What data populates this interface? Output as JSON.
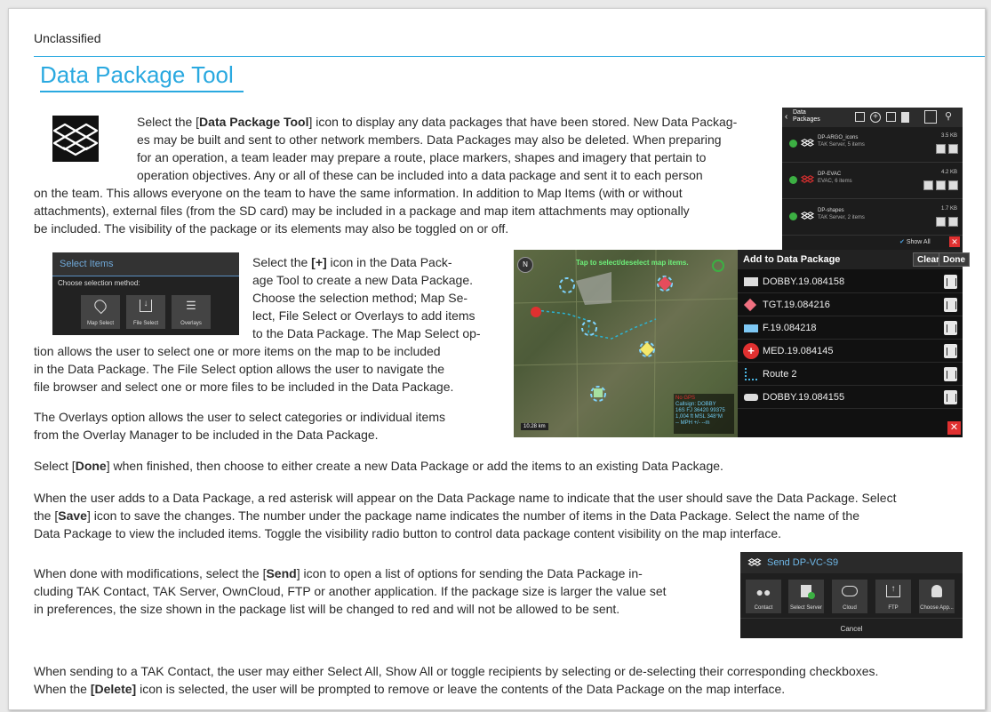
{
  "header": {
    "classification": "Unclassified",
    "title": "Data Package Tool"
  },
  "intro": {
    "l1_pre": "Select the [",
    "l1_bold": "Data Package Tool",
    "l1_post": "] icon to display any data packages that have been stored. New Data Packag-",
    "l2": "es may be built and sent to other network members. Data Packages may also be deleted. When preparing",
    "l3": "for an operation, a team leader may prepare a route, place markers, shapes and imagery that pertain to",
    "l4": "operation objectives. Any or all of these can be included into a data package and sent it to each person",
    "l5": "on the team. This allows everyone on the team to have the same information.  In addition to Map Items (with or without",
    "l6": "attachments), external files (from the SD card) may be included in a package and map item attachments may optionally",
    "l7": "be included. The visibility of the package or its elements may also be toggled on or off."
  },
  "data_packages_panel": {
    "title_line1": "Data",
    "title_line2": "Packages",
    "items": [
      {
        "name": "DP-ARGO_icons",
        "sub": "TAK Server, 5 items",
        "size": "3.5 KB"
      },
      {
        "name": "DP-EVAC",
        "sub": "EVAC, 6 items",
        "size": "4.2 KB"
      },
      {
        "name": "DP-shapes",
        "sub": "TAK Server, 2 items",
        "size": "1.7 KB"
      }
    ],
    "show_all": "Show All",
    "accent_green": "#3cb043",
    "accent_red": "#e03030"
  },
  "select_items_panel": {
    "title": "Select Items",
    "label": "Choose selection method:",
    "buttons": [
      {
        "label": "Map Select",
        "icon": "map-pin-icon"
      },
      {
        "label": "File Select",
        "icon": "download-icon"
      },
      {
        "label": "Overlays",
        "icon": "layers-icon"
      }
    ]
  },
  "create_text": {
    "l1_pre": "Select the ",
    "l1_bold": "[+]",
    "l1_post": " icon in the Data Pack-",
    "l2": "age Tool to create a new Data Package.",
    "l3": "Choose the selection method; Map Se-",
    "l4": "lect, File Select or Overlays to add items",
    "l5": "to the Data Package. The Map Select op-",
    "l6": "tion allows the user to select one or more items on the map to be included",
    "l7": "in the Data Package.  The File Select option allows the user to navigate the",
    "l8": "file browser and select one or more files to be included in the Data Package.",
    "l9": "The Overlays option allows the user to select categories or individual items",
    "l10": "from the Overlay Manager to be included in the Data Package."
  },
  "map": {
    "banner": "Tap to select/deselect map items.",
    "north": "N",
    "scale": "10.28 km",
    "info_title": "No GPS",
    "info_lines": [
      "Callsign: DOBBY",
      "16S FJ 36420 99375",
      "1,004 ft MSL     348°M",
      "-- MPH          +/- --m"
    ]
  },
  "add_panel": {
    "title": "Add to Data Package",
    "clear": "Clear",
    "done": "Done",
    "items": [
      {
        "name": "DOBBY.19.084158",
        "icon": "vehicle-icon"
      },
      {
        "name": "TGT.19.084216",
        "icon": "diamond-icon"
      },
      {
        "name": "F.19.084218",
        "icon": "rectangle-icon"
      },
      {
        "name": "MED.19.084145",
        "icon": "medical-icon"
      },
      {
        "name": "Route 2",
        "icon": "route-icon"
      },
      {
        "name": "DOBBY.19.084155",
        "icon": "vehicle-icon"
      }
    ]
  },
  "done_text": {
    "pre": "Select [",
    "bold": "Done",
    "post": "] when finished, then choose to either create a new Data Package or add the items to an existing Data Package."
  },
  "asterisk_text": {
    "l1": "When the user adds to a Data Package, a red asterisk will appear on the Data Package name to indicate that the user should save the Data Package. Select",
    "l2_pre": "the [",
    "l2_bold": "Save",
    "l2_post": "] icon to save the changes. The number under the package name indicates the number of items in the Data Package. Select the name of the",
    "l3": "Data Package to view the included items. Toggle the visibility radio button to control data package content visibility on the map interface."
  },
  "send_text": {
    "l1_pre": "When done with modifications, select the [",
    "l1_bold": "Send",
    "l1_post": "] icon to open a list of options for sending the Data Package in-",
    "l2": "cluding TAK Contact, TAK Server, OwnCloud, FTP or another application.  If the package size is larger the value set",
    "l3": "in preferences, the size shown in the package list will be changed to red and will not be allowed to be sent."
  },
  "send_panel": {
    "title": "Send DP-VC-S9",
    "buttons": [
      {
        "label": "Contact",
        "icon": "contacts-icon"
      },
      {
        "label": "Select Server",
        "icon": "server-icon"
      },
      {
        "label": "Cloud",
        "icon": "cloud-icon"
      },
      {
        "label": "FTP",
        "icon": "upload-icon"
      },
      {
        "label": "Choose App...",
        "icon": "android-icon"
      }
    ],
    "cancel": "Cancel"
  },
  "final_text": {
    "l1": "When sending to a TAK Contact, the user may either Select All, Show All or toggle recipients by selecting or de-selecting their corresponding checkboxes.",
    "l2_pre": "When the ",
    "l2_bold": "[Delete]",
    "l2_post": " icon is selected, the user will be prompted to remove or leave the contents of the Data Package on the map interface."
  }
}
